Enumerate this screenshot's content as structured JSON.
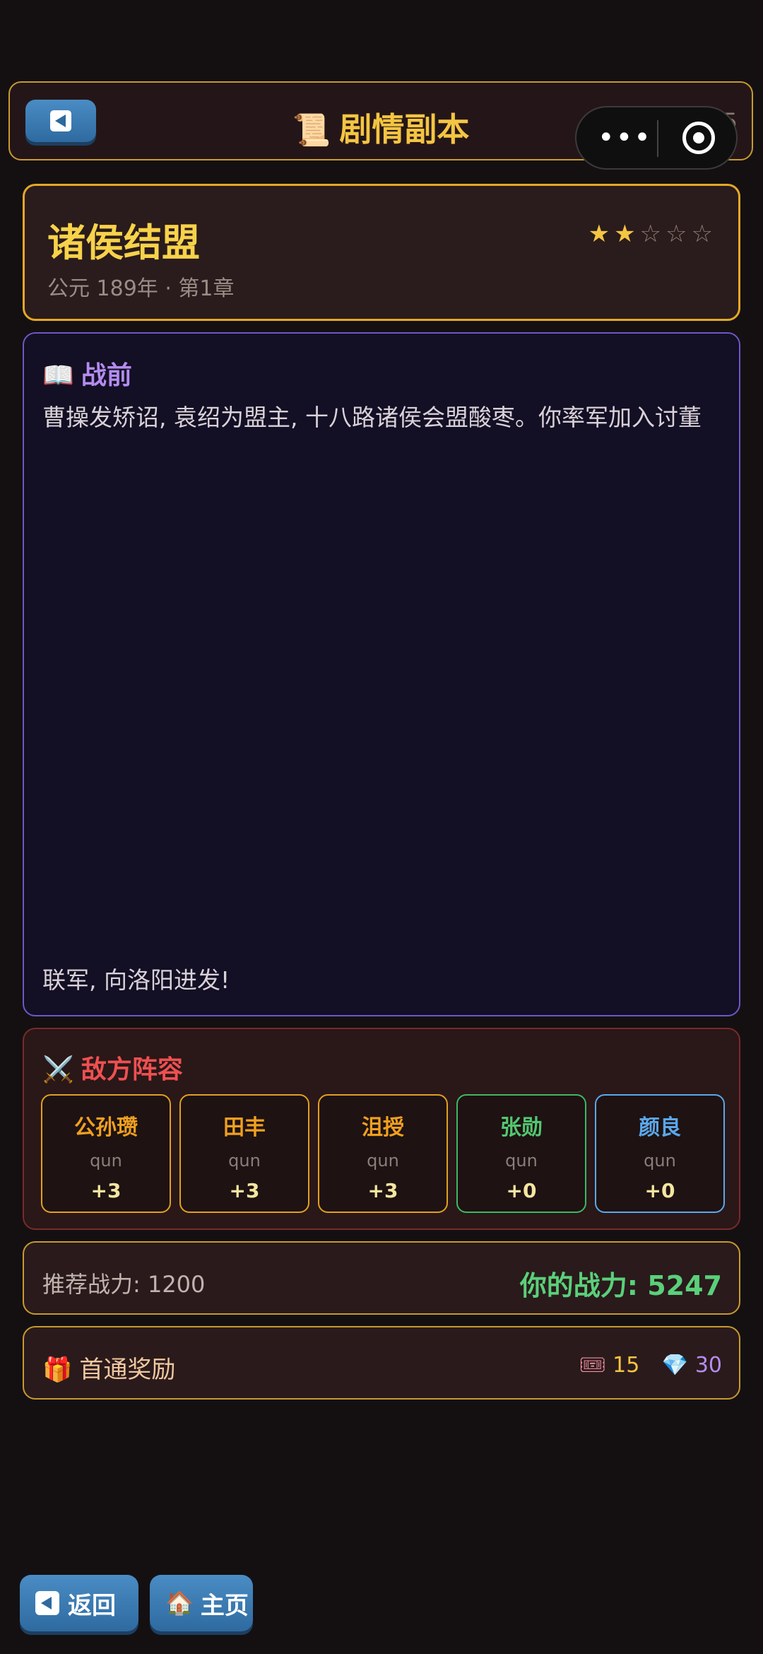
{
  "header": {
    "title": "剧情副本",
    "title_icon": "📜",
    "page_count": "4/35"
  },
  "stage": {
    "title": "诸侯结盟",
    "subtitle": "公元 189年 · 第1章",
    "stars_filled": 2,
    "stars_total": 5
  },
  "story": {
    "heading": "战前",
    "heading_icon": "📖",
    "text_line1": "曹操发矫诏, 袁绍为盟主, 十八路诸侯会盟酸枣。你率军加入讨董",
    "text_line2": "联军, 向洛阳进发!"
  },
  "enemy": {
    "heading": "敌方阵容",
    "heading_icon": "⚔️",
    "heroes": [
      {
        "name": "公孙瓒",
        "faction": "qun",
        "bonus": "+3"
      },
      {
        "name": "田丰",
        "faction": "qun",
        "bonus": "+3"
      },
      {
        "name": "沮授",
        "faction": "qun",
        "bonus": "+3"
      },
      {
        "name": "张勋",
        "faction": "qun",
        "bonus": "+0"
      },
      {
        "name": "颜良",
        "faction": "qun",
        "bonus": "+0"
      }
    ]
  },
  "power": {
    "recommended": "推荐战力: 1200",
    "yours": "你的战力: 5247"
  },
  "reward": {
    "label": "首通奖励",
    "label_icon": "🎁",
    "ticket_icon": "🎟",
    "ticket_count": "15",
    "gem_icon": "💎",
    "gem_count": "30"
  },
  "bottom": {
    "back_label": "返回",
    "home_label": "主页",
    "home_icon": "🏠"
  },
  "colors": {
    "gold": "#f4c542",
    "purple": "#b48cf0",
    "red": "#ee5050",
    "green": "#5ad07a",
    "blue": "#5aa8ec"
  }
}
